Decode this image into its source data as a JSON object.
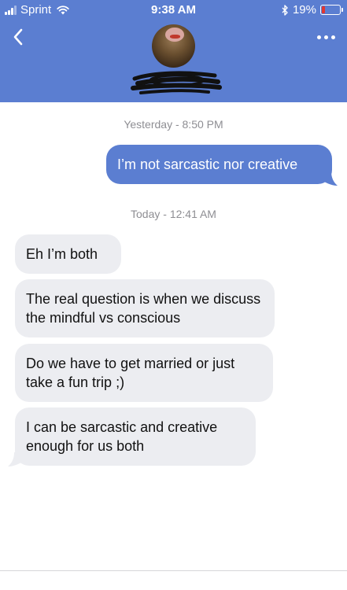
{
  "status_bar": {
    "carrier": "Sprint",
    "time": "9:38 AM",
    "battery_percent": "19%",
    "battery_level": 0.19,
    "icons": [
      "signal-icon",
      "wifi-icon",
      "bluetooth-icon",
      "battery-icon"
    ]
  },
  "header": {
    "back_icon": "chevron-left-icon",
    "more_icon": "ellipsis-icon",
    "contact_name_redacted": true,
    "background": "#5b7ed1"
  },
  "messages": {
    "timestamps": [
      "Yesterday - 8:50 PM",
      "Today - 12:41 AM"
    ],
    "outgoing": [
      {
        "text": "I’m not sarcastic nor creative"
      }
    ],
    "incoming": [
      {
        "text": "Eh I’m both"
      },
      {
        "text": "The real question is when we discuss the mindful vs conscious"
      },
      {
        "text": "Do we have to get married or just take a fun trip ;)"
      },
      {
        "text": "I can be sarcastic and creative enough for us both"
      }
    ]
  },
  "colors": {
    "outgoing_bubble": "#5b7ed1",
    "incoming_bubble": "#ecedf1",
    "timestamp_text": "#8e8e93",
    "battery_low": "#e2362f"
  }
}
